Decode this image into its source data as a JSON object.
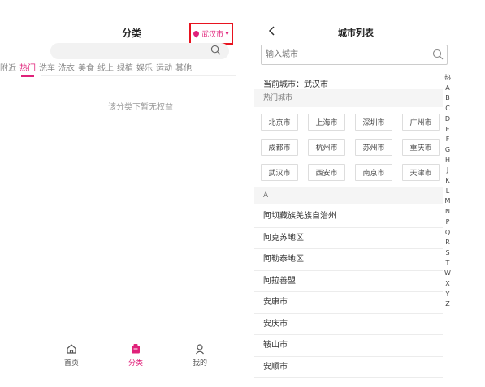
{
  "left": {
    "title": "分类",
    "city": "武汉市",
    "categories": [
      "附近",
      "热门",
      "洗车",
      "洗衣",
      "美食",
      "线上",
      "绿植",
      "娱乐",
      "运动",
      "其他"
    ],
    "active_category": 1,
    "empty_text": "该分类下暂无权益",
    "tabs": [
      {
        "label": "首页",
        "icon": "home-icon"
      },
      {
        "label": "分类",
        "icon": "category-icon"
      },
      {
        "label": "我的",
        "icon": "user-icon"
      }
    ],
    "active_tab": 1,
    "accent": "#e0217a",
    "highlight_box": "#e8131f"
  },
  "right": {
    "title": "城市列表",
    "search_placeholder": "输入城市",
    "current_city": "当前城市：武汉市",
    "hot_header": "热门城市",
    "hot_cities": [
      "北京市",
      "上海市",
      "深圳市",
      "广州市",
      "成都市",
      "杭州市",
      "苏州市",
      "重庆市",
      "武汉市",
      "西安市",
      "南京市",
      "天津市"
    ],
    "group_header": "A",
    "cities": [
      "阿坝藏族羌族自治州",
      "阿克苏地区",
      "阿勒泰地区",
      "阿拉善盟",
      "安康市",
      "安庆市",
      "鞍山市",
      "安顺市"
    ],
    "alphabet": [
      "热",
      "A",
      "B",
      "C",
      "D",
      "E",
      "F",
      "G",
      "H",
      "J",
      "K",
      "L",
      "M",
      "N",
      "P",
      "Q",
      "R",
      "S",
      "T",
      "W",
      "X",
      "Y",
      "Z"
    ]
  }
}
